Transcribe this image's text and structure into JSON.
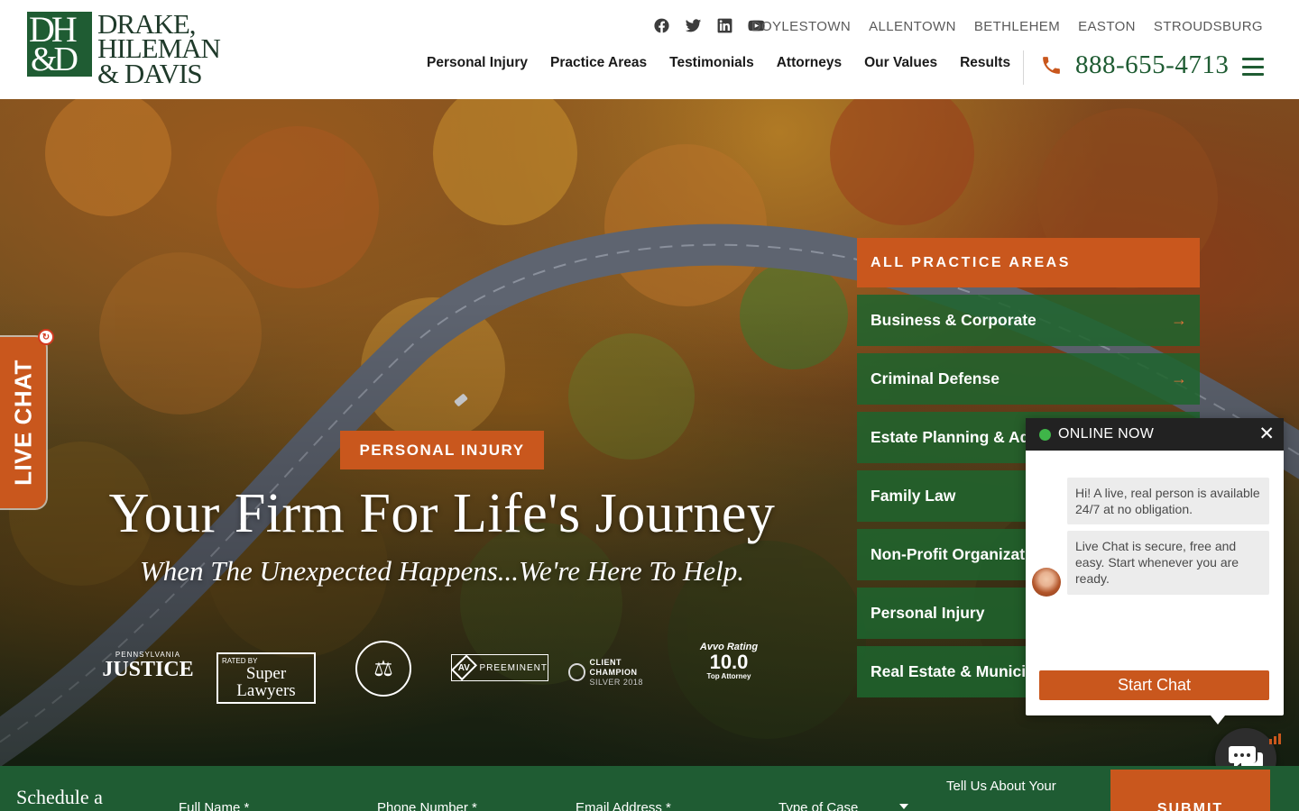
{
  "brand": {
    "monogram_top": "DH",
    "monogram_bottom": "&D",
    "line1": "DRAKE,",
    "line2": "HILEMAN",
    "line3": "& DAVIS"
  },
  "social": [
    {
      "name": "facebook-icon"
    },
    {
      "name": "twitter-icon"
    },
    {
      "name": "linkedin-icon"
    },
    {
      "name": "youtube-icon"
    }
  ],
  "locations": [
    "DOYLESTOWN",
    "ALLENTOWN",
    "BETHLEHEM",
    "EASTON",
    "STROUDSBURG"
  ],
  "nav": [
    "Personal Injury",
    "Practice Areas",
    "Testimonials",
    "Attorneys",
    "Our Values",
    "Results"
  ],
  "phone": "888-655-4713",
  "colors": {
    "accent": "#c9571d",
    "brand_green": "#1f5c33"
  },
  "hero": {
    "tag": "PERSONAL INJURY",
    "headline": "Your Firm For Life's Journey",
    "subhead": "When The Unexpected Happens...We're Here To Help."
  },
  "badges": {
    "justice_small": "PENNSYLVANIA",
    "justice_large": "JUSTICE",
    "super_small": "RATED BY",
    "super_large": "Super Lawyers",
    "av_mark": "AV",
    "av_text": "PREEMINENT",
    "client_text1": "CLIENT CHAMPION",
    "client_text2": "SILVER 2018",
    "avvo_small": "Avvo Rating",
    "avvo_score": "10.0",
    "avvo_text": "Top Attorney"
  },
  "practice_areas": {
    "header": "ALL PRACTICE AREAS",
    "items": [
      "Business & Corporate",
      "Criminal Defense",
      "Estate Planning & Adi",
      "Family Law",
      "Non-Profit Organizat",
      "Personal Injury",
      "Real Estate & Municip"
    ]
  },
  "live_chat_tab": "LIVE CHAT",
  "chat": {
    "status": "ONLINE NOW",
    "messages": [
      "Hi! A live, real person is available 24/7 at no obligation.",
      "Live Chat is secure, free and easy. Start whenever you are ready."
    ],
    "button": "Start Chat"
  },
  "schedule": {
    "title": "Schedule a",
    "full_name": "Full Name *",
    "phone_number": "Phone Number *",
    "email": "Email Address *",
    "case_type": "Type of Case",
    "tell_us": "Tell Us About Your",
    "submit": "SUBMIT"
  }
}
